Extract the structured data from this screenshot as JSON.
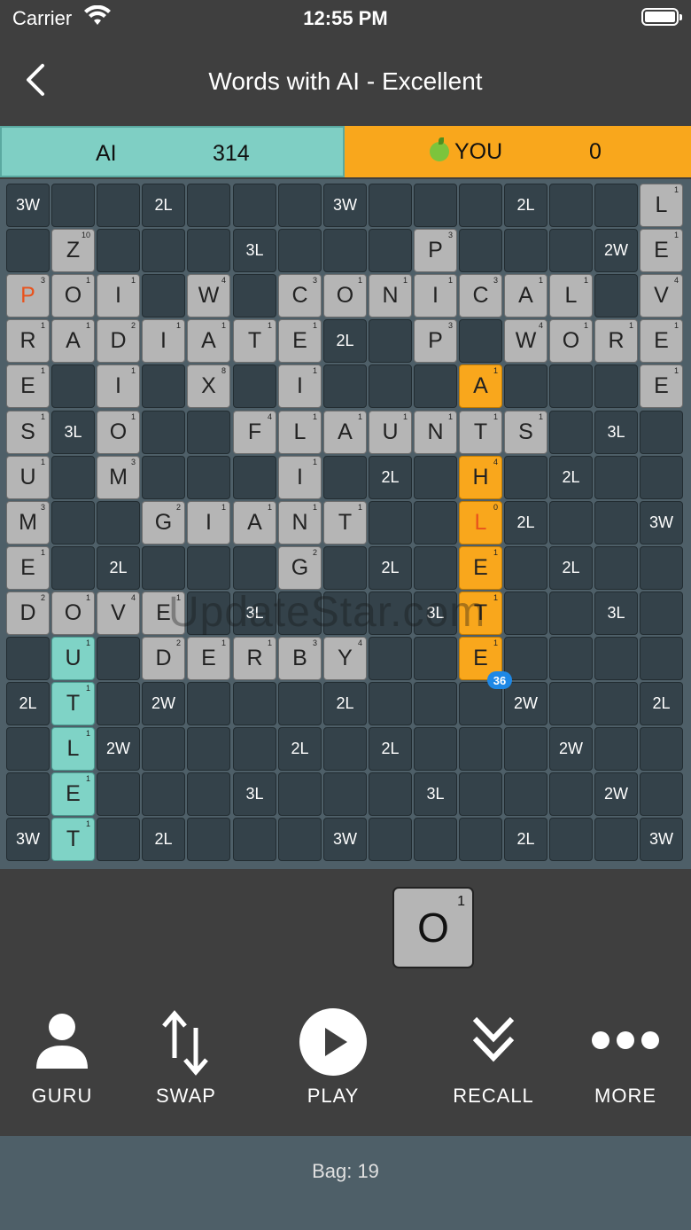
{
  "status": {
    "carrier": "Carrier",
    "time": "12:55 PM"
  },
  "nav": {
    "title": "Words with AI - Excellent"
  },
  "scores": {
    "ai_label": "AI",
    "ai_score": "314",
    "you_label": "YOU",
    "you_score": "0"
  },
  "board": {
    "bonus": [
      [
        0,
        0,
        "3W"
      ],
      [
        0,
        3,
        "2L"
      ],
      [
        0,
        7,
        "3W"
      ],
      [
        0,
        11,
        "2L"
      ],
      [
        1,
        5,
        "3L"
      ],
      [
        1,
        13,
        "2W"
      ],
      [
        3,
        7,
        "2L"
      ],
      [
        5,
        1,
        "3L"
      ],
      [
        5,
        13,
        "3L"
      ],
      [
        6,
        8,
        "2L"
      ],
      [
        6,
        12,
        "2L"
      ],
      [
        7,
        11,
        "2L"
      ],
      [
        7,
        14,
        "3W"
      ],
      [
        8,
        2,
        "2L"
      ],
      [
        8,
        8,
        "2L"
      ],
      [
        8,
        12,
        "2L"
      ],
      [
        9,
        5,
        "3L"
      ],
      [
        9,
        9,
        "3L"
      ],
      [
        9,
        13,
        "3L"
      ],
      [
        11,
        0,
        "2L"
      ],
      [
        11,
        3,
        "2W"
      ],
      [
        11,
        7,
        "2L"
      ],
      [
        11,
        11,
        "2W"
      ],
      [
        11,
        14,
        "2L"
      ],
      [
        12,
        2,
        "2W"
      ],
      [
        12,
        6,
        "2L"
      ],
      [
        12,
        8,
        "2L"
      ],
      [
        12,
        12,
        "2W"
      ],
      [
        13,
        5,
        "3L"
      ],
      [
        13,
        9,
        "3L"
      ],
      [
        13,
        13,
        "2W"
      ],
      [
        14,
        0,
        "3W"
      ],
      [
        14,
        3,
        "2L"
      ],
      [
        14,
        7,
        "3W"
      ],
      [
        14,
        11,
        "2L"
      ],
      [
        14,
        14,
        "3W"
      ]
    ],
    "tiles": [
      [
        0,
        14,
        "L",
        "1",
        "gray"
      ],
      [
        1,
        1,
        "Z",
        "10",
        "gray"
      ],
      [
        1,
        9,
        "P",
        "3",
        "gray"
      ],
      [
        1,
        14,
        "E",
        "1",
        "gray"
      ],
      [
        2,
        0,
        "P",
        "3",
        "gray-red"
      ],
      [
        2,
        1,
        "O",
        "1",
        "gray"
      ],
      [
        2,
        2,
        "I",
        "1",
        "gray"
      ],
      [
        2,
        4,
        "W",
        "4",
        "gray"
      ],
      [
        2,
        6,
        "C",
        "3",
        "gray"
      ],
      [
        2,
        7,
        "O",
        "1",
        "gray"
      ],
      [
        2,
        8,
        "N",
        "1",
        "gray"
      ],
      [
        2,
        9,
        "I",
        "1",
        "gray"
      ],
      [
        2,
        10,
        "C",
        "3",
        "gray"
      ],
      [
        2,
        11,
        "A",
        "1",
        "gray"
      ],
      [
        2,
        12,
        "L",
        "1",
        "gray"
      ],
      [
        2,
        14,
        "V",
        "4",
        "gray"
      ],
      [
        3,
        0,
        "R",
        "1",
        "gray"
      ],
      [
        3,
        1,
        "A",
        "1",
        "gray"
      ],
      [
        3,
        2,
        "D",
        "2",
        "gray"
      ],
      [
        3,
        3,
        "I",
        "1",
        "gray"
      ],
      [
        3,
        4,
        "A",
        "1",
        "gray"
      ],
      [
        3,
        5,
        "T",
        "1",
        "gray"
      ],
      [
        3,
        6,
        "E",
        "1",
        "gray"
      ],
      [
        3,
        9,
        "P",
        "3",
        "gray"
      ],
      [
        3,
        11,
        "W",
        "4",
        "gray"
      ],
      [
        3,
        12,
        "O",
        "1",
        "gray"
      ],
      [
        3,
        13,
        "R",
        "1",
        "gray"
      ],
      [
        3,
        14,
        "E",
        "1",
        "gray"
      ],
      [
        4,
        0,
        "E",
        "1",
        "gray"
      ],
      [
        4,
        2,
        "I",
        "1",
        "gray"
      ],
      [
        4,
        4,
        "X",
        "8",
        "gray"
      ],
      [
        4,
        6,
        "I",
        "1",
        "gray"
      ],
      [
        4,
        10,
        "A",
        "1",
        "orange"
      ],
      [
        4,
        14,
        "E",
        "1",
        "gray"
      ],
      [
        5,
        0,
        "S",
        "1",
        "gray"
      ],
      [
        5,
        2,
        "O",
        "1",
        "gray"
      ],
      [
        5,
        5,
        "F",
        "4",
        "gray"
      ],
      [
        5,
        6,
        "L",
        "1",
        "gray"
      ],
      [
        5,
        7,
        "A",
        "1",
        "gray"
      ],
      [
        5,
        8,
        "U",
        "1",
        "gray"
      ],
      [
        5,
        9,
        "N",
        "1",
        "gray"
      ],
      [
        5,
        10,
        "T",
        "1",
        "gray"
      ],
      [
        5,
        11,
        "S",
        "1",
        "gray"
      ],
      [
        6,
        0,
        "U",
        "1",
        "gray"
      ],
      [
        6,
        2,
        "M",
        "3",
        "gray"
      ],
      [
        6,
        6,
        "I",
        "1",
        "gray"
      ],
      [
        6,
        10,
        "H",
        "4",
        "orange"
      ],
      [
        7,
        0,
        "M",
        "3",
        "gray"
      ],
      [
        7,
        3,
        "G",
        "2",
        "gray"
      ],
      [
        7,
        4,
        "I",
        "1",
        "gray"
      ],
      [
        7,
        5,
        "A",
        "1",
        "gray"
      ],
      [
        7,
        6,
        "N",
        "1",
        "gray"
      ],
      [
        7,
        7,
        "T",
        "1",
        "gray"
      ],
      [
        7,
        10,
        "L",
        "0",
        "orange-red"
      ],
      [
        8,
        0,
        "E",
        "1",
        "gray"
      ],
      [
        8,
        6,
        "G",
        "2",
        "gray"
      ],
      [
        8,
        10,
        "E",
        "1",
        "orange"
      ],
      [
        9,
        0,
        "D",
        "2",
        "gray"
      ],
      [
        9,
        1,
        "O",
        "1",
        "gray"
      ],
      [
        9,
        2,
        "V",
        "4",
        "gray"
      ],
      [
        9,
        3,
        "E",
        "1",
        "gray"
      ],
      [
        9,
        10,
        "T",
        "1",
        "orange"
      ],
      [
        10,
        1,
        "U",
        "1",
        "green"
      ],
      [
        10,
        3,
        "D",
        "2",
        "gray"
      ],
      [
        10,
        4,
        "E",
        "1",
        "gray"
      ],
      [
        10,
        5,
        "R",
        "1",
        "gray"
      ],
      [
        10,
        6,
        "B",
        "3",
        "gray"
      ],
      [
        10,
        7,
        "Y",
        "4",
        "gray"
      ],
      [
        10,
        10,
        "E",
        "1",
        "orange"
      ],
      [
        11,
        1,
        "T",
        "1",
        "green"
      ],
      [
        12,
        1,
        "L",
        "1",
        "green"
      ],
      [
        13,
        1,
        "E",
        "1",
        "green"
      ],
      [
        14,
        1,
        "T",
        "1",
        "green"
      ]
    ],
    "badge": "36",
    "watermark": "UpdateStar.com"
  },
  "rack": {
    "letter": "O",
    "points": "1"
  },
  "toolbar": {
    "guru": "GURU",
    "swap": "SWAP",
    "play": "PLAY",
    "recall": "RECALL",
    "more": "MORE"
  },
  "bag": {
    "text": "Bag: 19"
  },
  "colors": {
    "tripleWord": "#d81e5b",
    "doubleWord": "#f48fb1",
    "tripleLetter": "#1e88e5",
    "doubleLetter": "#4fc3f7",
    "aiColor": "#7fcfc4",
    "youColor": "#f9a71c"
  }
}
